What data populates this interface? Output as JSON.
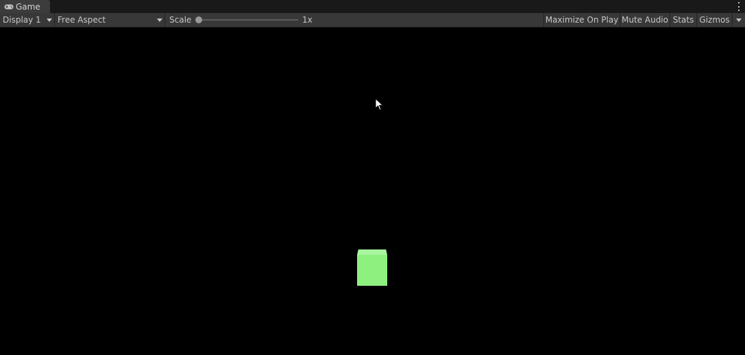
{
  "tab": {
    "title": "Game",
    "icon": "gamepad-icon"
  },
  "toolbar": {
    "display_dropdown": {
      "label": "Display 1",
      "icon": "chevron-down-icon"
    },
    "aspect_dropdown": {
      "label": "Free Aspect",
      "icon": "chevron-down-icon"
    },
    "scale": {
      "label": "Scale",
      "value_text": "1x",
      "level": 0.0
    },
    "buttons": {
      "maximize": "Maximize On Play",
      "mute": "Mute Audio",
      "stats": "Stats",
      "gizmos": "Gizmos"
    }
  },
  "viewport": {
    "background": "#000000",
    "cube_color": "#8ef07f",
    "cube_top_color": "#a9f4a0"
  },
  "colors": {
    "tab_background": "#3c3c3c",
    "toolbar_background": "#383838",
    "text": "#c8c8c8"
  }
}
